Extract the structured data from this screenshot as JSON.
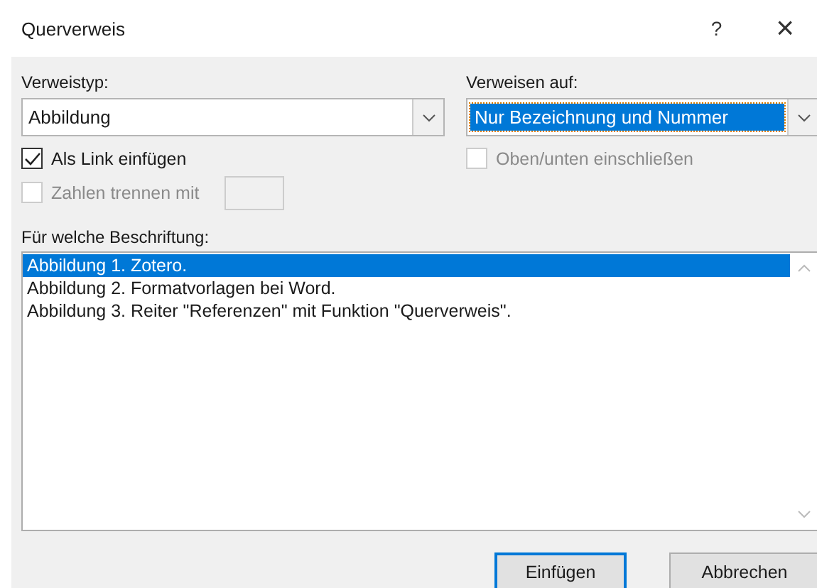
{
  "window": {
    "title": "Querverweis",
    "help": "?",
    "close": "×"
  },
  "reference_type": {
    "label": "Verweistyp:",
    "value": "Abbildung"
  },
  "reference_to": {
    "label": "Verweisen auf:",
    "value": "Nur Bezeichnung und Nummer",
    "selected": true
  },
  "options": [
    {
      "label": "Als Link einfügen",
      "checked": true,
      "disabled": false
    },
    {
      "label": "Oben/unten einschließen",
      "checked": false,
      "disabled": true
    },
    {
      "label": "Zahlen trennen mit",
      "checked": false,
      "disabled": true
    }
  ],
  "captions": {
    "label": "Für welche Beschriftung:",
    "items": [
      {
        "text": "Abbildung 1. Zotero.",
        "selected": true
      },
      {
        "text": "Abbildung 2. Formatvorlagen bei Word.",
        "selected": false
      },
      {
        "text": "Abbildung 3. Reiter \"Referenzen\" mit Funktion \"Querverweis\".",
        "selected": false
      }
    ]
  },
  "buttons": [
    {
      "label": "Einfügen",
      "focused": true
    },
    {
      "label": "Abbrechen",
      "focused": false
    }
  ]
}
